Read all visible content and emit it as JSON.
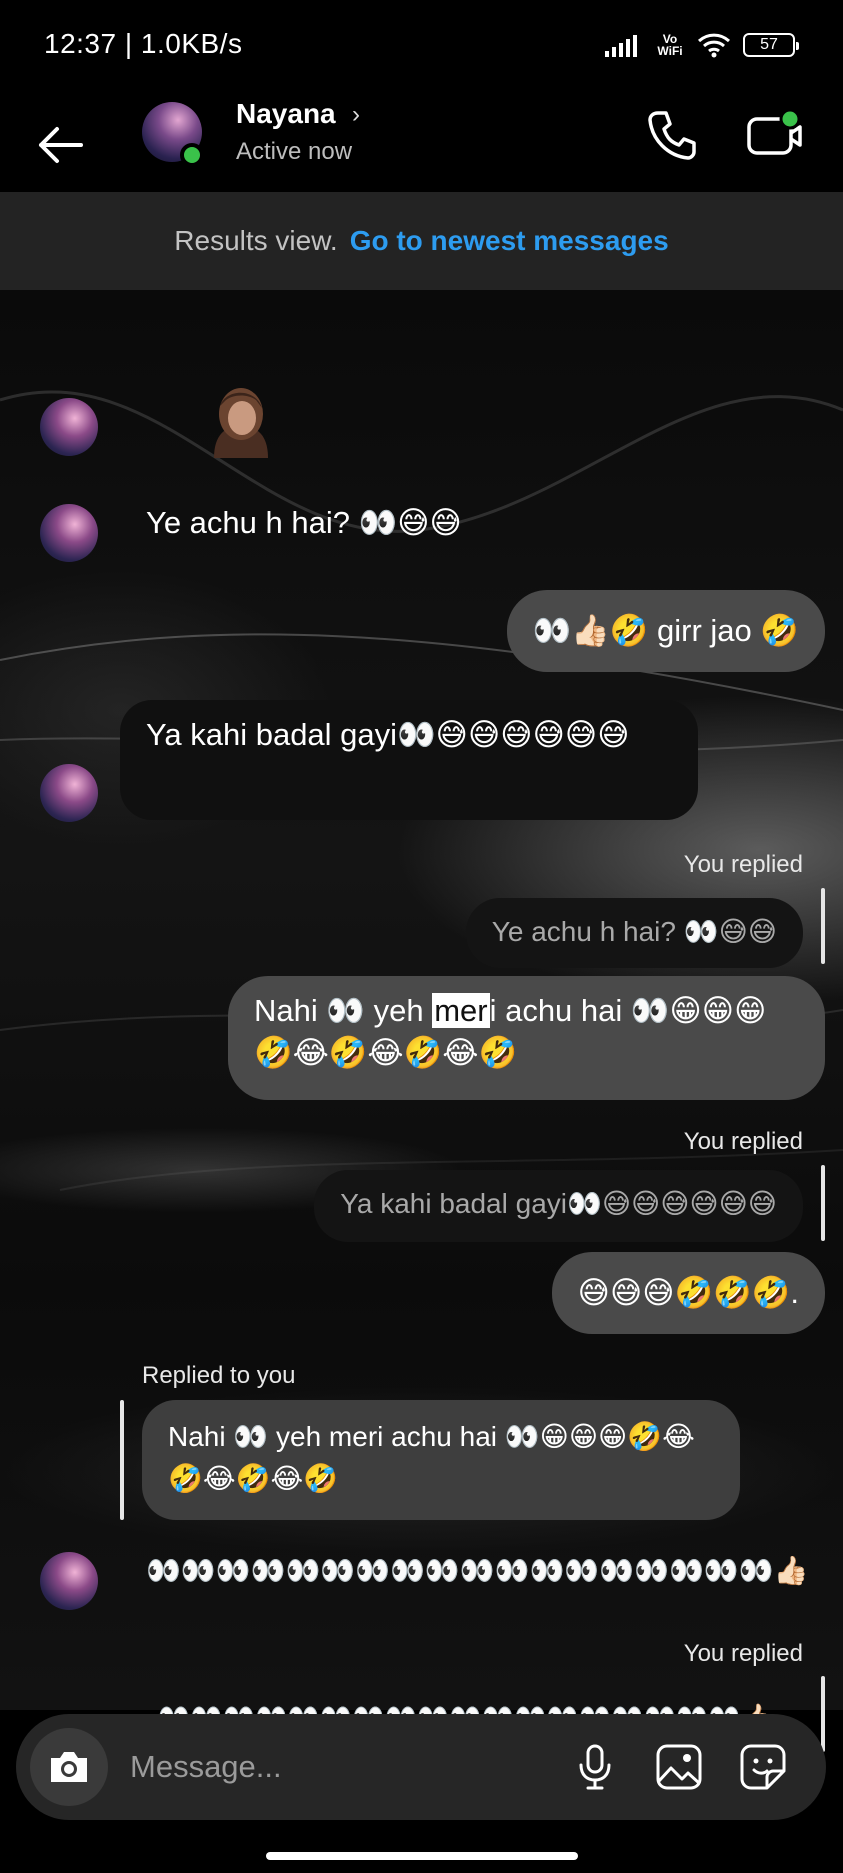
{
  "status_bar": {
    "time": "12:37 | 1.0KB/s",
    "vowifi": "Vo WiFi",
    "battery": "57"
  },
  "header": {
    "contact_name": "Nayana",
    "status": "Active now",
    "online_color": "#3ac24a"
  },
  "results_banner": {
    "text": "Results view.",
    "link": "Go to newest messages",
    "link_color": "#2d9cf0"
  },
  "messages": {
    "m1": "Ye achu h hai? 👀😅😅",
    "m2": "👀👍🏻🤣 girr jao 🤣",
    "m3": "Ya kahi badal gayi👀😅😅😅😅😅😅",
    "reply1_label": "You replied",
    "reply1_quote": "Ye achu h hai? 👀😅😅",
    "m4_part1": "Nahi 👀 yeh ",
    "m4_highlight": "mer",
    "m4_part2": "i achu hai 👀😁😁😁🤣😂🤣😂🤣😂🤣",
    "reply2_label": "You replied",
    "reply2_quote": "Ya kahi badal gayi👀😅😅😅😅😅😅",
    "m5": "😅😅😅🤣🤣🤣.",
    "reply3_label": "Replied to you",
    "reply3_quote": "Nahi 👀 yeh meri achu hai 👀😁😁😁🤣😂🤣😂🤣😂🤣",
    "m6": "👀👀👀👀👀👀👀👀👀👀👀👀👀👀👀👀👀👀👍🏻",
    "reply4_label": "You replied",
    "reply4_quote": "👀👀👀👀👀👀👀👀👀👀👀👀👀👀👀👀👀👀👍🏻"
  },
  "composer": {
    "placeholder": "Message..."
  },
  "icons": {
    "back": "back-arrow-icon",
    "call": "phone-icon",
    "video": "video-call-icon",
    "camera": "camera-icon",
    "mic": "microphone-icon",
    "gallery": "image-icon",
    "sticker": "sticker-icon"
  }
}
